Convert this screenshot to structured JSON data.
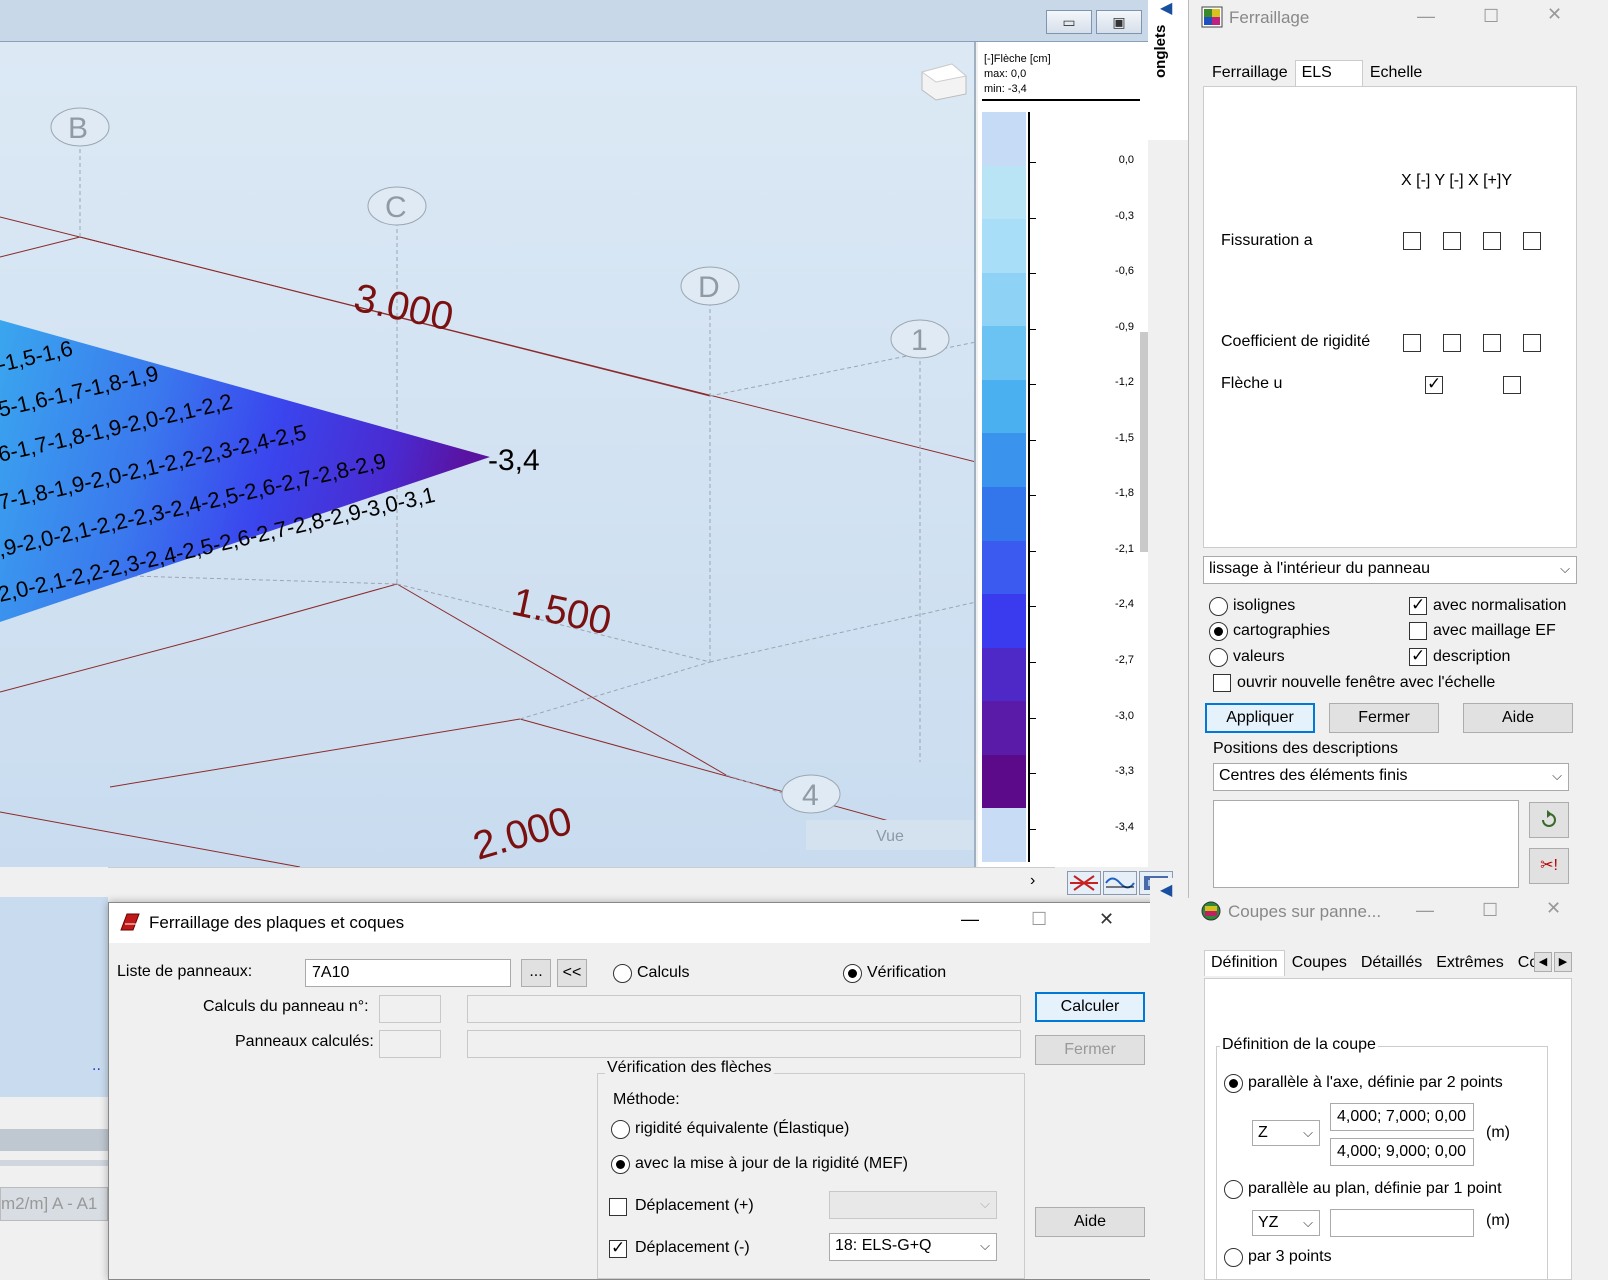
{
  "main_window": {
    "minimize_glyph": "▭",
    "maximize_glyph": "▣"
  },
  "viewport": {
    "axis_bubbles": [
      "B",
      "C",
      "D",
      "1",
      "4"
    ],
    "dimensions": [
      "3.000",
      "1.500",
      "2.000"
    ],
    "min_label": "-3,4",
    "vue_label": "Vue",
    "iso_rows": [
      "-1,5-1,6",
      "5-1,6-1,7-1,8-1,9",
      "6-1,7-1,8-1,9-2,0-2,1-2,2",
      "7-1,8-1,9-2,0-2,1-2,2-2,3-2,4-2,5",
      ",9-2,0-2,1-2,2-2,3-2,4-2,5-2,6-2,7-2,8-2,9",
      "2,0-2,1-2,2-2,3-2,4-2,5-2,6-2,7-2,8-2,9-3,0-3,1"
    ]
  },
  "legend": {
    "title": "[-]Flèche [cm]",
    "max": "max:    0,0",
    "min": "min: -3,4",
    "ticks": [
      "0,0",
      "-0,3",
      "-0,6",
      "-0,9",
      "-1,2",
      "-1,5",
      "-1,8",
      "-2,1",
      "-2,4",
      "-2,7",
      "-3,0",
      "-3,3",
      "-3,4"
    ],
    "colors": [
      "#c6dcf6",
      "#b8e4f6",
      "#a8def8",
      "#8ed3f6",
      "#6bc3f3",
      "#4ab0f0",
      "#3a94ee",
      "#3376ec",
      "#3a5af0",
      "#3a3bee",
      "#4f28c8",
      "#5a1ca8",
      "#5c0a8a",
      "#c9dcf6"
    ]
  },
  "onglets": {
    "label": "onglets",
    "arrow": "◀"
  },
  "ferraillage_panel": {
    "title": "Ferraillage",
    "tabs": [
      "Ferraillage",
      "ELS",
      "Echelle"
    ],
    "columns_header": "X [-] Y [-] X [+]Y",
    "rows": [
      {
        "label": "Fissuration a"
      },
      {
        "label": "Coefficient de rigidité"
      },
      {
        "label": "Flèche u"
      }
    ],
    "smoothing_select": "lissage à l'intérieur du panneau",
    "radios": [
      "isolignes",
      "cartographies",
      "valeurs"
    ],
    "checks": [
      "avec normalisation",
      "avec maillage EF",
      "description"
    ],
    "open_window_check": "ouvrir nouvelle fenêtre avec l'échelle",
    "buttons": [
      "Appliquer",
      "Fermer",
      "Aide"
    ],
    "positions_label": "Positions des descriptions",
    "positions_select": "Centres des éléments finis"
  },
  "dialog": {
    "title": "Ferraillage des plaques et coques",
    "panel_list_label": "Liste de panneaux:",
    "panel_list_value": "7A10",
    "browse_button": "...",
    "back_button": "<<",
    "mode_calculs": "Calculs",
    "mode_verification": "Vérification",
    "calc_panel_label": "Calculs du panneau n°:",
    "calculated_label": "Panneaux calculés:",
    "calculer_button": "Calculer",
    "fermer_button": "Fermer",
    "aide_button": "Aide",
    "group_title": "Vérification des flèches",
    "methode_label": "Méthode:",
    "method_options": [
      "rigidité équivalente (Élastique)",
      "avec la mise à jour de la rigidité (MEF)"
    ],
    "disp_plus_label": "Déplacement (+)",
    "disp_minus_label": "Déplacement (-)",
    "disp_minus_value": "18: ELS-G+Q"
  },
  "left_under": {
    "dots": "..",
    "status": "m2/m] A - A1"
  },
  "coupes_panel": {
    "title": "Coupes sur panne...",
    "tabs": [
      "Définition",
      "Coupes",
      "Détaillés",
      "Extrêmes",
      "Com"
    ],
    "group_title": "Définition de la coupe",
    "option1": "parallèle à l'axe, définie par 2 points",
    "axis_select": "Z",
    "point1": "4,000; 7,000; 0,00",
    "point2": "4,000; 9,000; 0,00",
    "unit": "(m)",
    "option2": "parallèle au plan, définie par 1 point",
    "plane_select": "YZ",
    "option3": "par 3 points"
  }
}
